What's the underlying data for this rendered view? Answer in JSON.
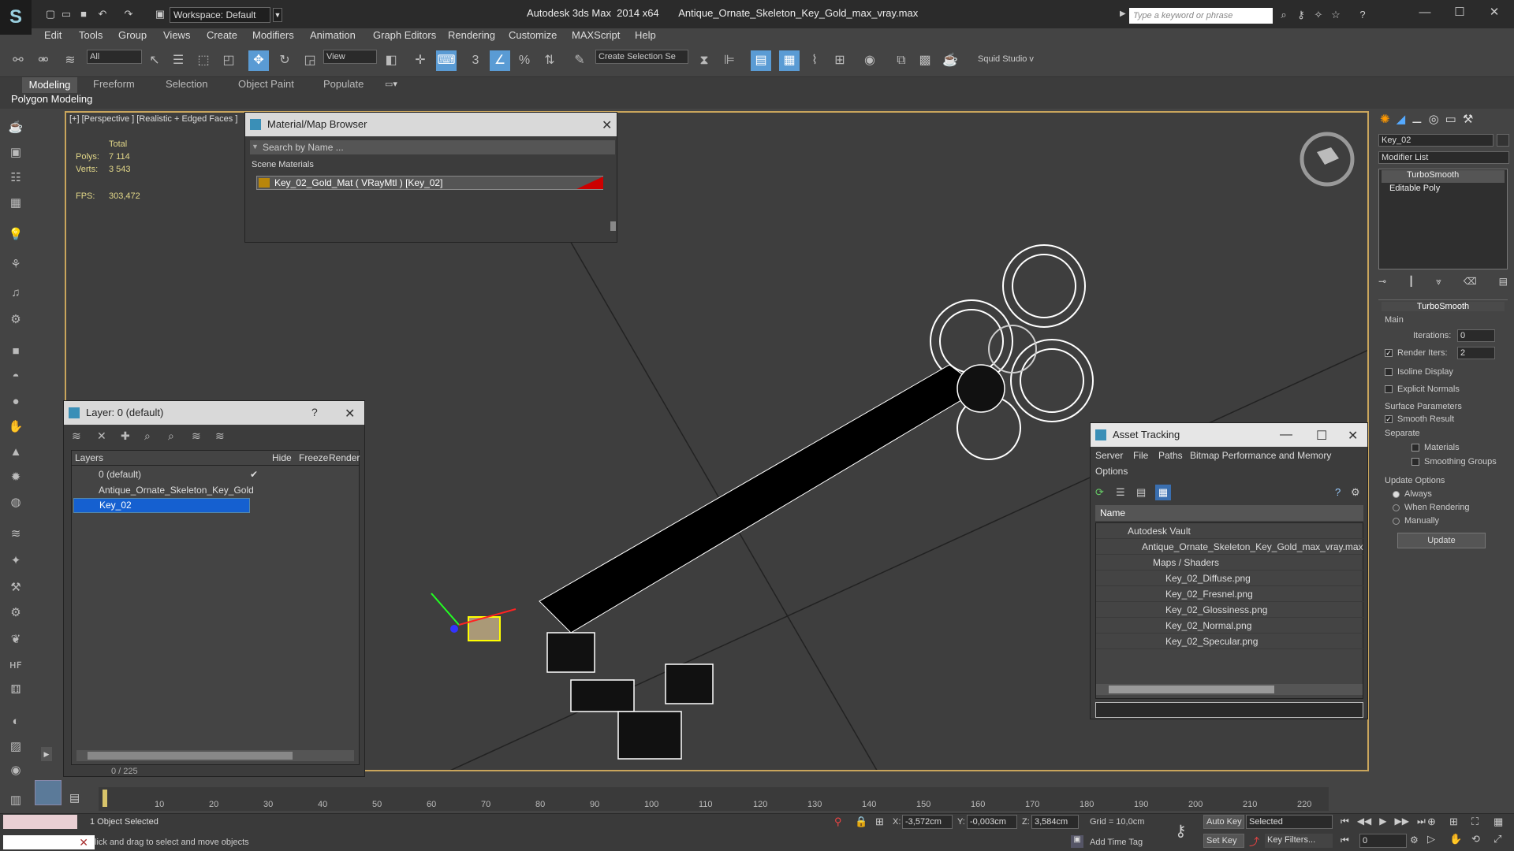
{
  "app": {
    "logo": "S",
    "workspace": "Workspace: Default",
    "title": "Autodesk 3ds Max  2014 x64       Antique_Ornate_Skeleton_Key_Gold_max_vray.max",
    "search_placeholder": "Type a keyword or phrase"
  },
  "menu": [
    "Edit",
    "Tools",
    "Group",
    "Views",
    "Create",
    "Modifiers",
    "Animation",
    "Graph Editors",
    "Rendering",
    "Customize",
    "MAXScript",
    "Help"
  ],
  "toolbar": {
    "selection_filter": "All",
    "ref_coord": "View",
    "named_selection": "Create Selection Se",
    "snap_label": "3",
    "plugin_label": "Squid Studio v"
  },
  "ribbon": {
    "tabs": [
      "Modeling",
      "Freeform",
      "Selection",
      "Object Paint",
      "Populate"
    ],
    "subtab": "Polygon Modeling"
  },
  "viewport": {
    "label": "[+] [Perspective ] [Realistic + Edged Faces ]",
    "stats_total": "Total",
    "polys_label": "Polys:",
    "polys_value": "7 114",
    "verts_label": "Verts:",
    "verts_value": "3 543",
    "fps_label": "FPS:",
    "fps_value": "303,472"
  },
  "material_browser": {
    "title": "Material/Map Browser",
    "search_placeholder": "Search by Name ...",
    "section": "Scene Materials",
    "item": "Key_02_Gold_Mat  ( VRayMtl ) [Key_02]"
  },
  "layer_panel": {
    "title": "Layer: 0 (default)",
    "help": "?",
    "columns": [
      "Layers",
      "Hide",
      "Freeze",
      "Render"
    ],
    "rows": [
      "0 (default)",
      "Antique_Ornate_Skeleton_Key_Gold",
      "Key_02"
    ],
    "counter": "0 / 225"
  },
  "asset_tracking": {
    "title": "Asset Tracking",
    "menu": [
      "Server",
      "File",
      "Paths",
      "Bitmap Performance and Memory",
      "Options"
    ],
    "column": "Name",
    "rows": [
      "Autodesk Vault",
      "Antique_Ornate_Skeleton_Key_Gold_max_vray.max",
      "Maps / Shaders",
      "Key_02_Diffuse.png",
      "Key_02_Fresnel.png",
      "Key_02_Glossiness.png",
      "Key_02_Normal.png",
      "Key_02_Specular.png"
    ]
  },
  "command_panel": {
    "object_name": "Key_02",
    "modifier_list": "Modifier List",
    "stack": [
      "TurboSmooth",
      "Editable Poly"
    ],
    "rollout_title": "TurboSmooth",
    "main": "Main",
    "iterations_label": "Iterations:",
    "iterations_value": "0",
    "render_iters_label": "Render Iters:",
    "render_iters_value": "2",
    "isoline": "Isoline Display",
    "explicit_normals": "Explicit Normals",
    "surface_params": "Surface Parameters",
    "smooth_result": "Smooth Result",
    "separate": "Separate",
    "materials": "Materials",
    "smoothing_groups": "Smoothing Groups",
    "update_options": "Update Options",
    "always": "Always",
    "when_rendering": "When Rendering",
    "manually": "Manually",
    "update_btn": "Update"
  },
  "timeline": {
    "ticks": [
      "10",
      "20",
      "30",
      "40",
      "50",
      "60",
      "70",
      "80",
      "90",
      "100",
      "110",
      "120",
      "130",
      "140",
      "150",
      "160",
      "170",
      "180",
      "190",
      "200",
      "210",
      "220"
    ]
  },
  "status": {
    "selected": "1 Object Selected",
    "prompt": "lick and drag to select and move objects",
    "x_label": "X:",
    "x_value": "-3,572cm",
    "y_label": "Y:",
    "y_value": "-0,003cm",
    "z_label": "Z:",
    "z_value": "3,584cm",
    "grid": "Grid = 10,0cm",
    "add_time_tag": "Add Time Tag",
    "auto_key": "Auto Key",
    "auto_key_mode": "Selected",
    "set_key": "Set Key",
    "key_filters": "Key Filters...",
    "frame": "0"
  }
}
